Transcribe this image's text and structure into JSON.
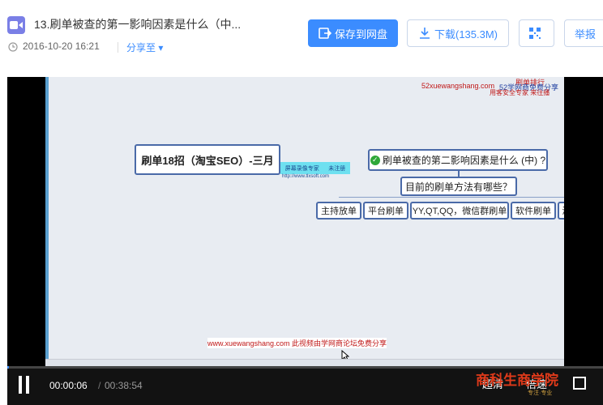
{
  "header": {
    "title": "13.刷单被查的第一影响因素是什么（中...",
    "date": "2016-10-20 16:21",
    "share_label": "分享至",
    "file_icon": "video-file-icon"
  },
  "actions": {
    "save_label": "保存到网盘",
    "download_label": "下载(135.3M)",
    "qr_icon": "qr-code-icon",
    "report_label": "举报"
  },
  "video": {
    "watermark_top_site": "52xuewangshang.com",
    "watermark_top_share": "52学网商免费分享",
    "watermark_top_tag": "刷单排行",
    "watermark_top_tag2": "用客安全专家  来往播",
    "sticker_left": "屏幕录像专家",
    "sticker_right": "未注册",
    "sticker_url": "http://www.tlxsoft.com",
    "watermark_bottom": "www.xuewangshang.com  此视频由学网商论坛免费分享",
    "root_node": "刷单18招（淘宝SEO）-三月",
    "question_node": "刷单被查的第二影响因素是什么 (中) ?",
    "method_node": "目前的刷单方法有哪些？",
    "leaves": [
      "主持放单",
      "平台刷单",
      "YY,QT,QQ，微信群刷单",
      "软件刷单",
      "淘"
    ]
  },
  "controls": {
    "current_time": "00:00:06",
    "separator": "/",
    "total_time": "00:38:54",
    "progress_fraction": 0.003,
    "quality_label": "超清",
    "speed_label": "倍速",
    "logo_text": "商科生商学院",
    "logo_sub": "专注·专业"
  },
  "colors": {
    "accent": "#3b8cff",
    "node_border": "#4a6aa8",
    "watermark_red": "#c01818"
  }
}
